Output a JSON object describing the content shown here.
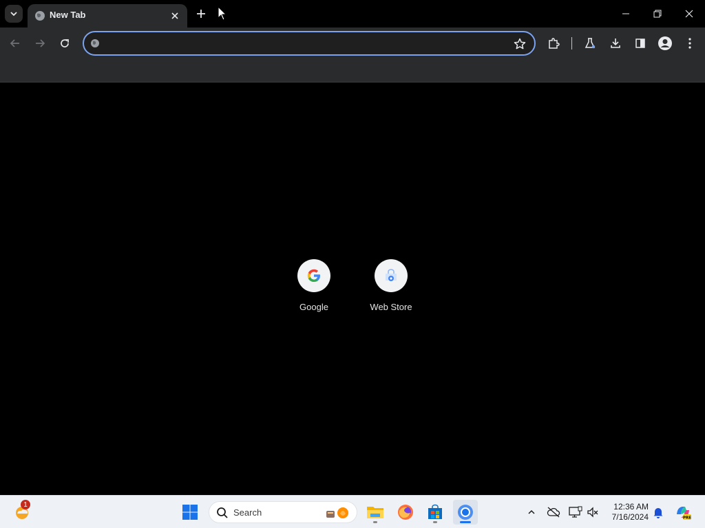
{
  "browser": {
    "tab": {
      "title": "New Tab"
    },
    "omnibox": {
      "value": "",
      "placeholder": ""
    }
  },
  "shortcuts": [
    {
      "label": "Google",
      "icon": "google-g-icon"
    },
    {
      "label": "Web Store",
      "icon": "web-store-icon"
    }
  ],
  "taskbar": {
    "search_label": "Search",
    "weather_badge": "1",
    "clock": {
      "time": "12:36 AM",
      "date": "7/16/2024"
    }
  },
  "colors": {
    "omnibox_border": "#7ca3f0",
    "toolbar_bg": "#2a2b2d",
    "page_bg": "#000000",
    "taskbar_bg": "#eef1f6"
  }
}
